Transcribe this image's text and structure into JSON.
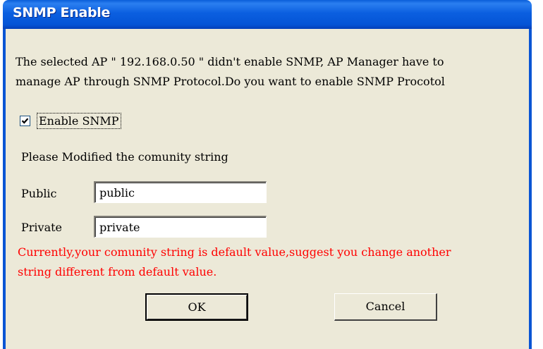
{
  "dialog": {
    "title": "SNMP Enable",
    "message_line1": "The selected AP \" 192.168.0.50 \" didn't enable SNMP, AP Manager have to",
    "message_line2": "manage AP through SNMP Protocol.Do you want to enable SNMP Procotol",
    "enable_snmp": {
      "label": "Enable SNMP",
      "checked": true
    },
    "community_prompt": "Please Modified the comunity string",
    "public_label": "Public",
    "public_value": "public",
    "private_label": "Private",
    "private_value": "private",
    "warning_line1": "Currently,your comunity string is default value,suggest you change another",
    "warning_line2": "string different from default value.",
    "ok_label": "OK",
    "cancel_label": "Cancel"
  },
  "colors": {
    "titlebar": "#0454d6",
    "dialog_bg": "#ece9d8",
    "warning_text": "#ff0000"
  }
}
